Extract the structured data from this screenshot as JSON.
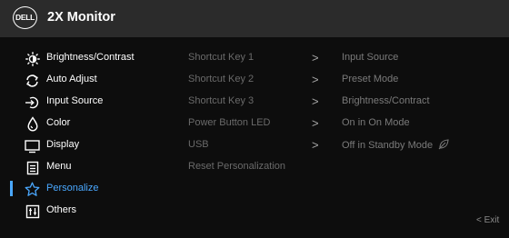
{
  "header": {
    "logo_text": "DELL",
    "title": "2X Monitor"
  },
  "menu": {
    "items": [
      {
        "label": "Brightness/Contrast",
        "icon": "brightness-icon"
      },
      {
        "label": "Auto Adjust",
        "icon": "auto-adjust-icon"
      },
      {
        "label": "Input Source",
        "icon": "input-source-icon"
      },
      {
        "label": "Color",
        "icon": "color-icon"
      },
      {
        "label": "Display",
        "icon": "display-icon"
      },
      {
        "label": "Menu",
        "icon": "menu-icon"
      },
      {
        "label": "Personalize",
        "icon": "star-icon",
        "active": true
      },
      {
        "label": "Others",
        "icon": "others-icon"
      }
    ]
  },
  "personalize": {
    "rows": [
      {
        "name": "Shortcut Key 1",
        "arrow": ">",
        "value": "Input Source"
      },
      {
        "name": "Shortcut Key 2",
        "arrow": ">",
        "value": "Preset Mode"
      },
      {
        "name": "Shortcut Key 3",
        "arrow": ">",
        "value": "Brightness/Contract"
      },
      {
        "name": "Power Button LED",
        "arrow": ">",
        "value": "On in On Mode"
      },
      {
        "name": "USB",
        "arrow": ">",
        "value": "Off in Standby Mode"
      },
      {
        "name": "Reset Personalization",
        "arrow": "",
        "value": ""
      }
    ]
  },
  "footer": {
    "exit_label": "< Exit"
  },
  "colors": {
    "accent": "#4aa8ff",
    "background": "#0d0d0d",
    "header": "#2b2b2b"
  }
}
